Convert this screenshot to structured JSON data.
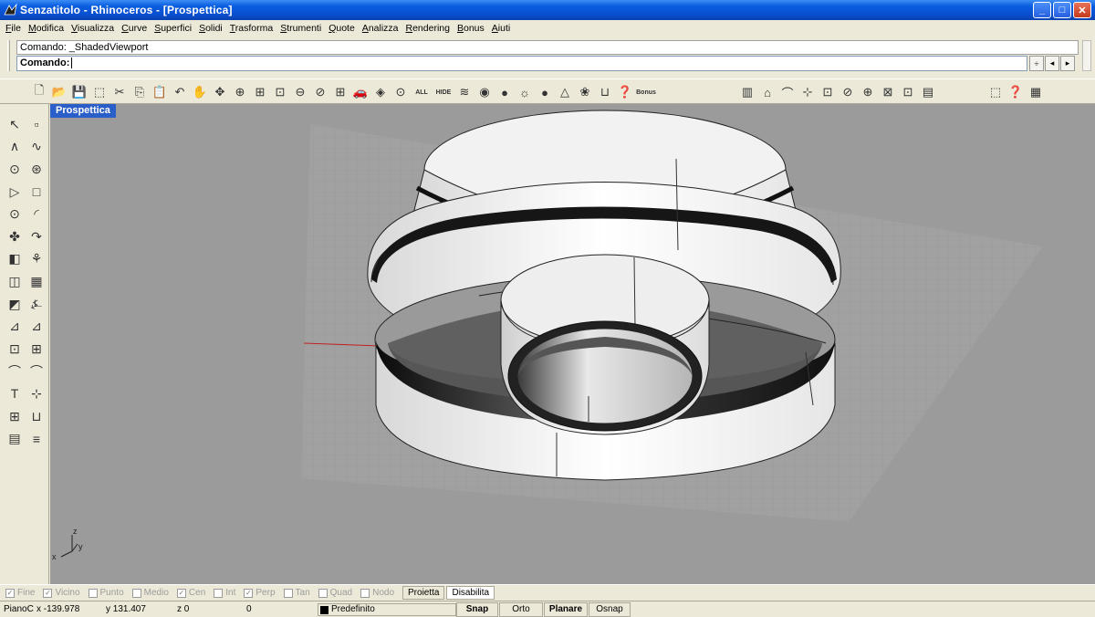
{
  "window": {
    "title": "Senzatitolo - Rhinoceros - [Prospettica]",
    "controls": {
      "minimize": "_",
      "maximize": "□",
      "close": "✕"
    }
  },
  "menu": [
    {
      "label": "File",
      "u": "F",
      "rest": "ile"
    },
    {
      "label": "Modifica",
      "u": "M",
      "rest": "odifica"
    },
    {
      "label": "Visualizza",
      "u": "V",
      "rest": "isualizza"
    },
    {
      "label": "Curve",
      "u": "C",
      "rest": "urve"
    },
    {
      "label": "Superfici",
      "u": "S",
      "rest": "uperfici"
    },
    {
      "label": "Solidi",
      "u": "S",
      "rest": "olidi"
    },
    {
      "label": "Trasforma",
      "u": "T",
      "rest": "rasforma"
    },
    {
      "label": "Strumenti",
      "u": "S",
      "rest": "trumenti"
    },
    {
      "label": "Quote",
      "u": "Q",
      "rest": "uote"
    },
    {
      "label": "Analizza",
      "u": "A",
      "rest": "nalizza"
    },
    {
      "label": "Rendering",
      "u": "R",
      "rest": "endering"
    },
    {
      "label": "Bonus",
      "u": "B",
      "rest": "onus"
    },
    {
      "label": "Aiuti",
      "u": "A",
      "rest": "iuti"
    }
  ],
  "command": {
    "history": "Comando: _ShadedViewport",
    "prompt": "Comando:"
  },
  "toolbar": {
    "main": [
      "🗋",
      "📂",
      "💾",
      "⬚",
      "✂",
      "⎘",
      "📋",
      "↶",
      "✋",
      "✥",
      "⊕",
      "⊞",
      "⊡",
      "⊖",
      "⊘",
      "⊞",
      "🚗",
      "◈",
      "⊙",
      "ALL",
      "HIDE",
      "≋",
      "◉",
      "●",
      "☼",
      "●",
      "△",
      "❀",
      "⊔",
      "❓",
      "Bonus"
    ],
    "right": [
      "▥",
      "⌂",
      "⌒",
      "⊹",
      "⊡",
      "⊘",
      "⊕",
      "⊠",
      "⊡",
      "▤"
    ],
    "far": [
      "⬚",
      "❓",
      "▦"
    ],
    "labels": {
      "all": "ALL",
      "hide": "HIDE",
      "bonus": "Bonus",
      "bonus_small": "BONUS"
    }
  },
  "lefttoolbar": [
    "↖",
    "▫",
    "∧",
    "∿",
    "⊙",
    "⊛",
    "▷",
    "□",
    "⊙",
    "◜",
    "✤",
    "↷",
    "◧",
    "⚘",
    "◫",
    "▦",
    "◩",
    "⍼",
    "⊿",
    "⊿",
    "⊡",
    "⊞",
    "⌒",
    "⌒",
    "T",
    "⊹",
    "⊞",
    "⊔",
    "▤",
    "≡"
  ],
  "viewport": {
    "name": "Prospettica",
    "axis": {
      "x": "x",
      "y": "y",
      "z": "z"
    }
  },
  "osnap": {
    "items": [
      {
        "label": "Fine",
        "checked": true
      },
      {
        "label": "Vicino",
        "checked": true
      },
      {
        "label": "Punto",
        "checked": false
      },
      {
        "label": "Medio",
        "checked": false
      },
      {
        "label": "Cen",
        "checked": true
      },
      {
        "label": "Int",
        "checked": false
      },
      {
        "label": "Perp",
        "checked": true
      },
      {
        "label": "Tan",
        "checked": false
      },
      {
        "label": "Quad",
        "checked": false
      },
      {
        "label": "Nodo",
        "checked": false
      }
    ],
    "proietta": "Proietta",
    "disabilita": "Disabilita"
  },
  "status": {
    "cplane": "PianoC",
    "x": "x -139.978",
    "y": "y 131.407",
    "z": "z 0",
    "extra": "0",
    "layer": "Predefinito",
    "snap": "Snap",
    "orto": "Orto",
    "planare": "Planare",
    "osnap": "Osnap"
  }
}
